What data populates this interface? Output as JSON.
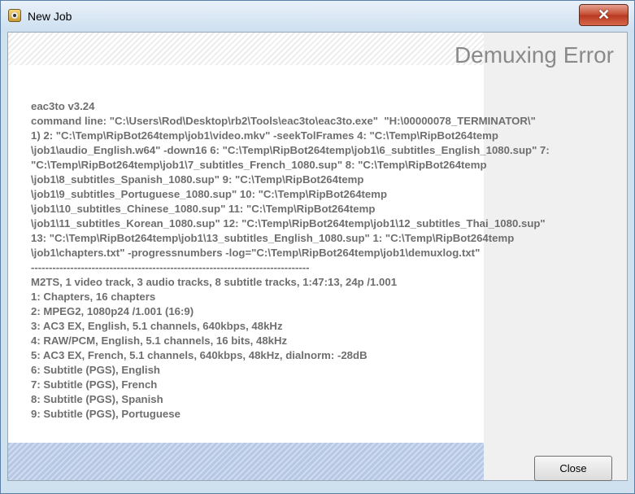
{
  "window": {
    "title": "New Job",
    "close_glyph": "✕",
    "icon": "ripbot-app-icon"
  },
  "dialog": {
    "heading": "Demuxing Error",
    "log_lines": [
      "eac3to v3.24",
      "command line: \"C:\\Users\\Rod\\Desktop\\rb2\\Tools\\eac3to\\eac3to.exe\"  \"H:\\00000078_TERMINATOR\\\"",
      "1) 2: \"C:\\Temp\\RipBot264temp\\job1\\video.mkv\" -seekTolFrames 4: \"C:\\Temp\\RipBot264temp",
      "\\job1\\audio_English.w64\" -down16 6: \"C:\\Temp\\RipBot264temp\\job1\\6_subtitles_English_1080.sup\" 7:",
      "\"C:\\Temp\\RipBot264temp\\job1\\7_subtitles_French_1080.sup\" 8: \"C:\\Temp\\RipBot264temp",
      "\\job1\\8_subtitles_Spanish_1080.sup\" 9: \"C:\\Temp\\RipBot264temp",
      "\\job1\\9_subtitles_Portuguese_1080.sup\" 10: \"C:\\Temp\\RipBot264temp",
      "\\job1\\10_subtitles_Chinese_1080.sup\" 11: \"C:\\Temp\\RipBot264temp",
      "\\job1\\11_subtitles_Korean_1080.sup\" 12: \"C:\\Temp\\RipBot264temp\\job1\\12_subtitles_Thai_1080.sup\"",
      "13: \"C:\\Temp\\RipBot264temp\\job1\\13_subtitles_English_1080.sup\" 1: \"C:\\Temp\\RipBot264temp",
      "\\job1\\chapters.txt\" -progressnumbers -log=\"C:\\Temp\\RipBot264temp\\job1\\demuxlog.txt\"",
      "------------------------------------------------------------------------------",
      "M2TS, 1 video track, 3 audio tracks, 8 subtitle tracks, 1:47:13, 24p /1.001",
      "1: Chapters, 16 chapters",
      "2: MPEG2, 1080p24 /1.001 (16:9)",
      "3: AC3 EX, English, 5.1 channels, 640kbps, 48kHz",
      "4: RAW/PCM, English, 5.1 channels, 16 bits, 48kHz",
      "5: AC3 EX, French, 5.1 channels, 640kbps, 48kHz, dialnorm: -28dB",
      "6: Subtitle (PGS), English",
      "7: Subtitle (PGS), French",
      "8: Subtitle (PGS), Spanish",
      "9: Subtitle (PGS), Portuguese"
    ],
    "close_label": "Close"
  },
  "colors": {
    "heading": "#8a8a8a",
    "log_text": "#6e6e6e",
    "close_x_bg": "#c44a2f",
    "window_frame": "#cfe0ef"
  }
}
